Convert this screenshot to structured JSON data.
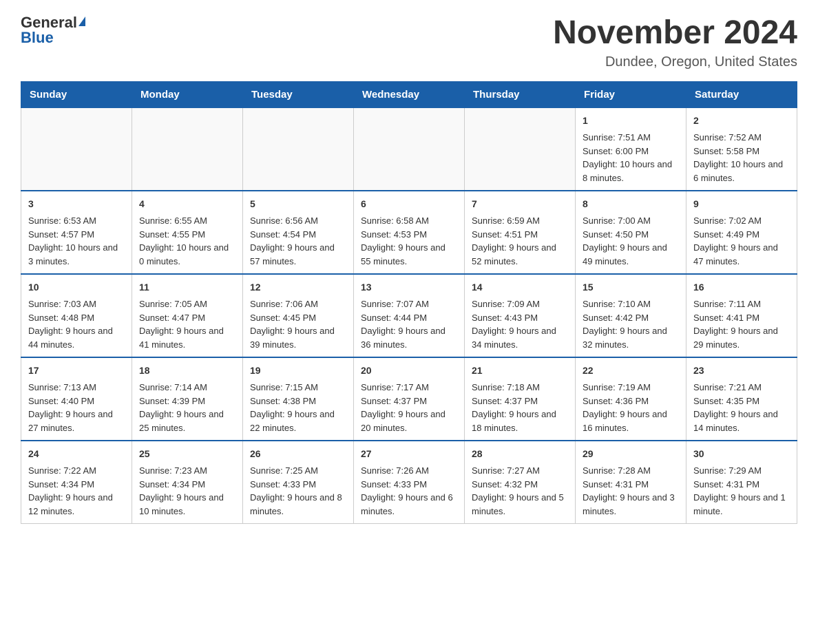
{
  "header": {
    "logo_general": "General",
    "logo_blue": "Blue",
    "title": "November 2024",
    "subtitle": "Dundee, Oregon, United States"
  },
  "days_of_week": [
    "Sunday",
    "Monday",
    "Tuesday",
    "Wednesday",
    "Thursday",
    "Friday",
    "Saturday"
  ],
  "weeks": [
    [
      {
        "day": "",
        "empty": true
      },
      {
        "day": "",
        "empty": true
      },
      {
        "day": "",
        "empty": true
      },
      {
        "day": "",
        "empty": true
      },
      {
        "day": "",
        "empty": true
      },
      {
        "day": "1",
        "sunrise": "Sunrise: 7:51 AM",
        "sunset": "Sunset: 6:00 PM",
        "daylight": "Daylight: 10 hours and 8 minutes."
      },
      {
        "day": "2",
        "sunrise": "Sunrise: 7:52 AM",
        "sunset": "Sunset: 5:58 PM",
        "daylight": "Daylight: 10 hours and 6 minutes."
      }
    ],
    [
      {
        "day": "3",
        "sunrise": "Sunrise: 6:53 AM",
        "sunset": "Sunset: 4:57 PM",
        "daylight": "Daylight: 10 hours and 3 minutes."
      },
      {
        "day": "4",
        "sunrise": "Sunrise: 6:55 AM",
        "sunset": "Sunset: 4:55 PM",
        "daylight": "Daylight: 10 hours and 0 minutes."
      },
      {
        "day": "5",
        "sunrise": "Sunrise: 6:56 AM",
        "sunset": "Sunset: 4:54 PM",
        "daylight": "Daylight: 9 hours and 57 minutes."
      },
      {
        "day": "6",
        "sunrise": "Sunrise: 6:58 AM",
        "sunset": "Sunset: 4:53 PM",
        "daylight": "Daylight: 9 hours and 55 minutes."
      },
      {
        "day": "7",
        "sunrise": "Sunrise: 6:59 AM",
        "sunset": "Sunset: 4:51 PM",
        "daylight": "Daylight: 9 hours and 52 minutes."
      },
      {
        "day": "8",
        "sunrise": "Sunrise: 7:00 AM",
        "sunset": "Sunset: 4:50 PM",
        "daylight": "Daylight: 9 hours and 49 minutes."
      },
      {
        "day": "9",
        "sunrise": "Sunrise: 7:02 AM",
        "sunset": "Sunset: 4:49 PM",
        "daylight": "Daylight: 9 hours and 47 minutes."
      }
    ],
    [
      {
        "day": "10",
        "sunrise": "Sunrise: 7:03 AM",
        "sunset": "Sunset: 4:48 PM",
        "daylight": "Daylight: 9 hours and 44 minutes."
      },
      {
        "day": "11",
        "sunrise": "Sunrise: 7:05 AM",
        "sunset": "Sunset: 4:47 PM",
        "daylight": "Daylight: 9 hours and 41 minutes."
      },
      {
        "day": "12",
        "sunrise": "Sunrise: 7:06 AM",
        "sunset": "Sunset: 4:45 PM",
        "daylight": "Daylight: 9 hours and 39 minutes."
      },
      {
        "day": "13",
        "sunrise": "Sunrise: 7:07 AM",
        "sunset": "Sunset: 4:44 PM",
        "daylight": "Daylight: 9 hours and 36 minutes."
      },
      {
        "day": "14",
        "sunrise": "Sunrise: 7:09 AM",
        "sunset": "Sunset: 4:43 PM",
        "daylight": "Daylight: 9 hours and 34 minutes."
      },
      {
        "day": "15",
        "sunrise": "Sunrise: 7:10 AM",
        "sunset": "Sunset: 4:42 PM",
        "daylight": "Daylight: 9 hours and 32 minutes."
      },
      {
        "day": "16",
        "sunrise": "Sunrise: 7:11 AM",
        "sunset": "Sunset: 4:41 PM",
        "daylight": "Daylight: 9 hours and 29 minutes."
      }
    ],
    [
      {
        "day": "17",
        "sunrise": "Sunrise: 7:13 AM",
        "sunset": "Sunset: 4:40 PM",
        "daylight": "Daylight: 9 hours and 27 minutes."
      },
      {
        "day": "18",
        "sunrise": "Sunrise: 7:14 AM",
        "sunset": "Sunset: 4:39 PM",
        "daylight": "Daylight: 9 hours and 25 minutes."
      },
      {
        "day": "19",
        "sunrise": "Sunrise: 7:15 AM",
        "sunset": "Sunset: 4:38 PM",
        "daylight": "Daylight: 9 hours and 22 minutes."
      },
      {
        "day": "20",
        "sunrise": "Sunrise: 7:17 AM",
        "sunset": "Sunset: 4:37 PM",
        "daylight": "Daylight: 9 hours and 20 minutes."
      },
      {
        "day": "21",
        "sunrise": "Sunrise: 7:18 AM",
        "sunset": "Sunset: 4:37 PM",
        "daylight": "Daylight: 9 hours and 18 minutes."
      },
      {
        "day": "22",
        "sunrise": "Sunrise: 7:19 AM",
        "sunset": "Sunset: 4:36 PM",
        "daylight": "Daylight: 9 hours and 16 minutes."
      },
      {
        "day": "23",
        "sunrise": "Sunrise: 7:21 AM",
        "sunset": "Sunset: 4:35 PM",
        "daylight": "Daylight: 9 hours and 14 minutes."
      }
    ],
    [
      {
        "day": "24",
        "sunrise": "Sunrise: 7:22 AM",
        "sunset": "Sunset: 4:34 PM",
        "daylight": "Daylight: 9 hours and 12 minutes."
      },
      {
        "day": "25",
        "sunrise": "Sunrise: 7:23 AM",
        "sunset": "Sunset: 4:34 PM",
        "daylight": "Daylight: 9 hours and 10 minutes."
      },
      {
        "day": "26",
        "sunrise": "Sunrise: 7:25 AM",
        "sunset": "Sunset: 4:33 PM",
        "daylight": "Daylight: 9 hours and 8 minutes."
      },
      {
        "day": "27",
        "sunrise": "Sunrise: 7:26 AM",
        "sunset": "Sunset: 4:33 PM",
        "daylight": "Daylight: 9 hours and 6 minutes."
      },
      {
        "day": "28",
        "sunrise": "Sunrise: 7:27 AM",
        "sunset": "Sunset: 4:32 PM",
        "daylight": "Daylight: 9 hours and 5 minutes."
      },
      {
        "day": "29",
        "sunrise": "Sunrise: 7:28 AM",
        "sunset": "Sunset: 4:31 PM",
        "daylight": "Daylight: 9 hours and 3 minutes."
      },
      {
        "day": "30",
        "sunrise": "Sunrise: 7:29 AM",
        "sunset": "Sunset: 4:31 PM",
        "daylight": "Daylight: 9 hours and 1 minute."
      }
    ]
  ]
}
